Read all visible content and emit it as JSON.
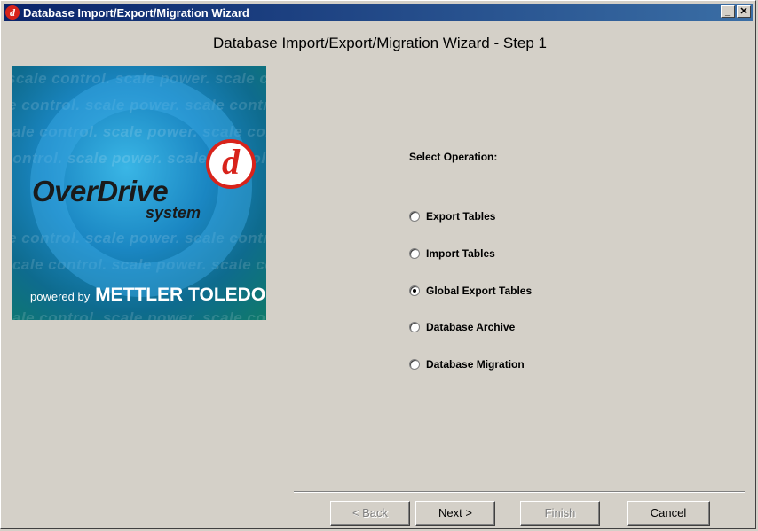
{
  "window": {
    "title": "Database Import/Export/Migration Wizard",
    "minimize_glyph": "_",
    "close_glyph": "✕"
  },
  "heading": "Database Import/Export/Migration Wizard - Step 1",
  "logo": {
    "icon": "overdrive-logo",
    "brand": "OverDrive",
    "subtitle": "system",
    "d_letter": "d",
    "powered_prefix": "powered by",
    "powered_brand": "METTLER TOLEDO",
    "watermark": "scale control. scale power. scale control. scale power."
  },
  "operation": {
    "label": "Select Operation:",
    "options": [
      {
        "label": "Export Tables",
        "checked": false
      },
      {
        "label": "Import Tables",
        "checked": false
      },
      {
        "label": "Global Export Tables",
        "checked": true
      },
      {
        "label": "Database Archive",
        "checked": false
      },
      {
        "label": "Database Migration",
        "checked": false
      }
    ]
  },
  "buttons": {
    "back": "< Back",
    "next": "Next >",
    "finish": "Finish",
    "cancel": "Cancel"
  },
  "colors": {
    "titlebar_start": "#0a246a",
    "titlebar_end": "#3a6ea5",
    "dialog_bg": "#d4d0c8",
    "brand_red": "#d8231b"
  }
}
